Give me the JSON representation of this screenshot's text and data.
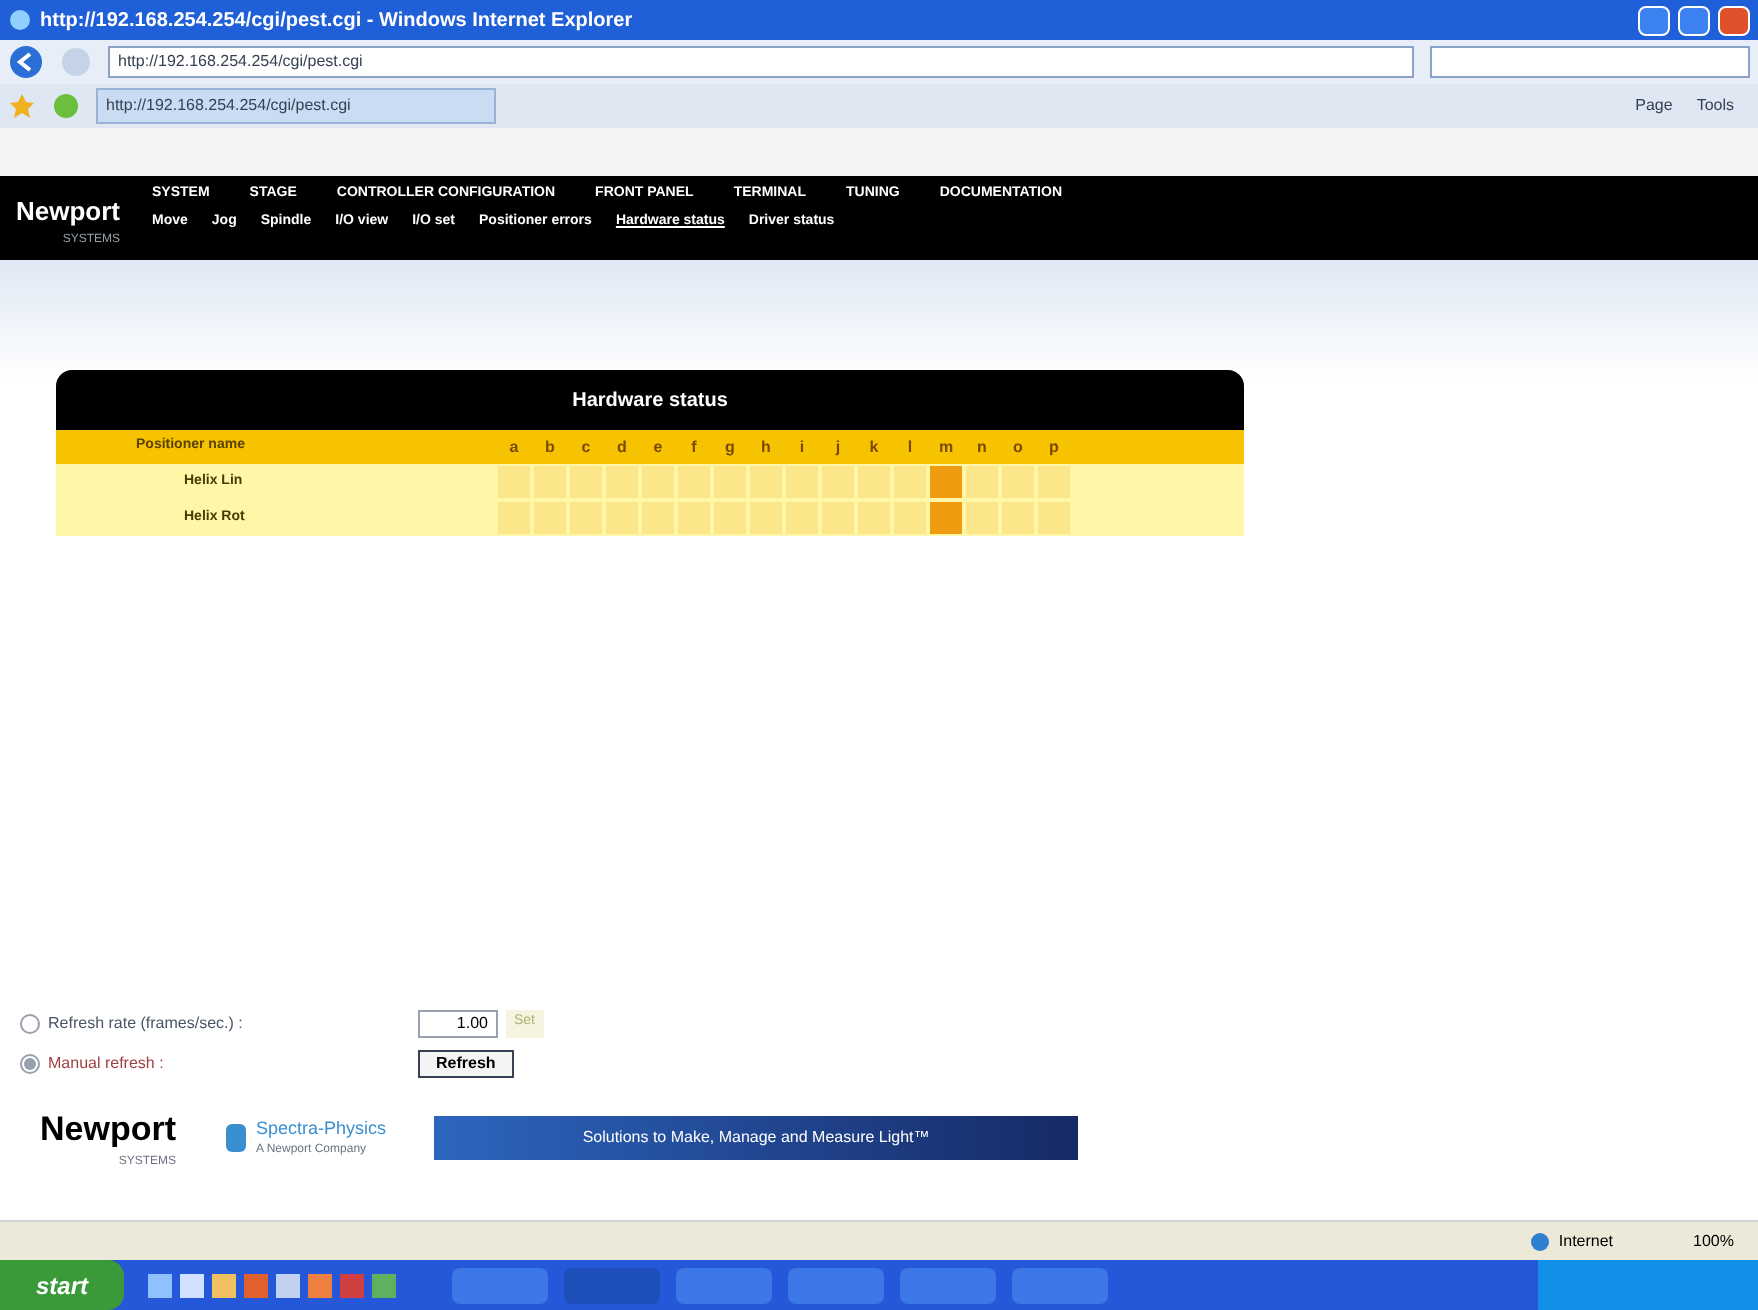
{
  "window": {
    "title": "http://192.168.254.254/cgi/pest.cgi - Windows Internet Explorer"
  },
  "address_bar": {
    "value": "http://192.168.254.254/cgi/pest.cgi"
  },
  "tab": {
    "label": "http://192.168.254.254/cgi/pest.cgi"
  },
  "command_bar": [
    "Page",
    "Tools"
  ],
  "site": {
    "logo": "Newport",
    "logo_sub": "SYSTEMS",
    "nav": [
      {
        "label": "SYSTEM"
      },
      {
        "label": "STAGE"
      },
      {
        "label": "CONTROLLER CONFIGURATION"
      },
      {
        "label": "FRONT PANEL"
      },
      {
        "label": "TERMINAL"
      },
      {
        "label": "TUNING"
      },
      {
        "label": "DOCUMENTATION"
      }
    ],
    "subnav": [
      {
        "label": "Move",
        "selected": false
      },
      {
        "label": "Jog",
        "selected": false
      },
      {
        "label": "Spindle",
        "selected": false
      },
      {
        "label": "I/O view",
        "selected": false
      },
      {
        "label": "I/O set",
        "selected": false
      },
      {
        "label": "Positioner errors",
        "selected": false
      },
      {
        "label": "Hardware status",
        "selected": true
      },
      {
        "label": "Driver status",
        "selected": false
      }
    ]
  },
  "table": {
    "title": "Hardware status",
    "name_column": "Positioner name",
    "columns": [
      "a",
      "b",
      "c",
      "d",
      "e",
      "f",
      "g",
      "h",
      "i",
      "j",
      "k",
      "l",
      "m",
      "n",
      "o",
      "p"
    ],
    "rows": [
      {
        "name": "Helix Lin",
        "cells": [
          {
            "on": false
          },
          {
            "on": false
          },
          {
            "on": false
          },
          {
            "on": false
          },
          {
            "on": false
          },
          {
            "on": false
          },
          {
            "on": false
          },
          {
            "on": false
          },
          {
            "on": false
          },
          {
            "on": false
          },
          {
            "on": false
          },
          {
            "on": false
          },
          {
            "on": true
          },
          {
            "on": false
          },
          {
            "on": false
          },
          {
            "on": false
          }
        ]
      },
      {
        "name": "Helix Rot",
        "cells": [
          {
            "on": false
          },
          {
            "on": false
          },
          {
            "on": false
          },
          {
            "on": false
          },
          {
            "on": false
          },
          {
            "on": false
          },
          {
            "on": false
          },
          {
            "on": false
          },
          {
            "on": false
          },
          {
            "on": false
          },
          {
            "on": false
          },
          {
            "on": false
          },
          {
            "on": true
          },
          {
            "on": false
          },
          {
            "on": false
          },
          {
            "on": false
          }
        ]
      }
    ]
  },
  "refresh": {
    "options": [
      {
        "label": "Refresh rate (frames/sec.) :",
        "selected": false,
        "kind": "rate",
        "value": "1.00",
        "button": "Set"
      },
      {
        "label": "Manual refresh :",
        "selected": true,
        "kind": "manual",
        "button": "Refresh"
      }
    ]
  },
  "footer": {
    "logo": "Newport",
    "logo_sub": "SYSTEMS",
    "partner": "Spectra-Physics",
    "partner_sub": "A Newport Company",
    "banner": "Solutions to Make, Manage and Measure Light™"
  },
  "status_bar": {
    "zone": "Internet",
    "zoom": "100%"
  },
  "taskbar": {
    "start": "start"
  }
}
